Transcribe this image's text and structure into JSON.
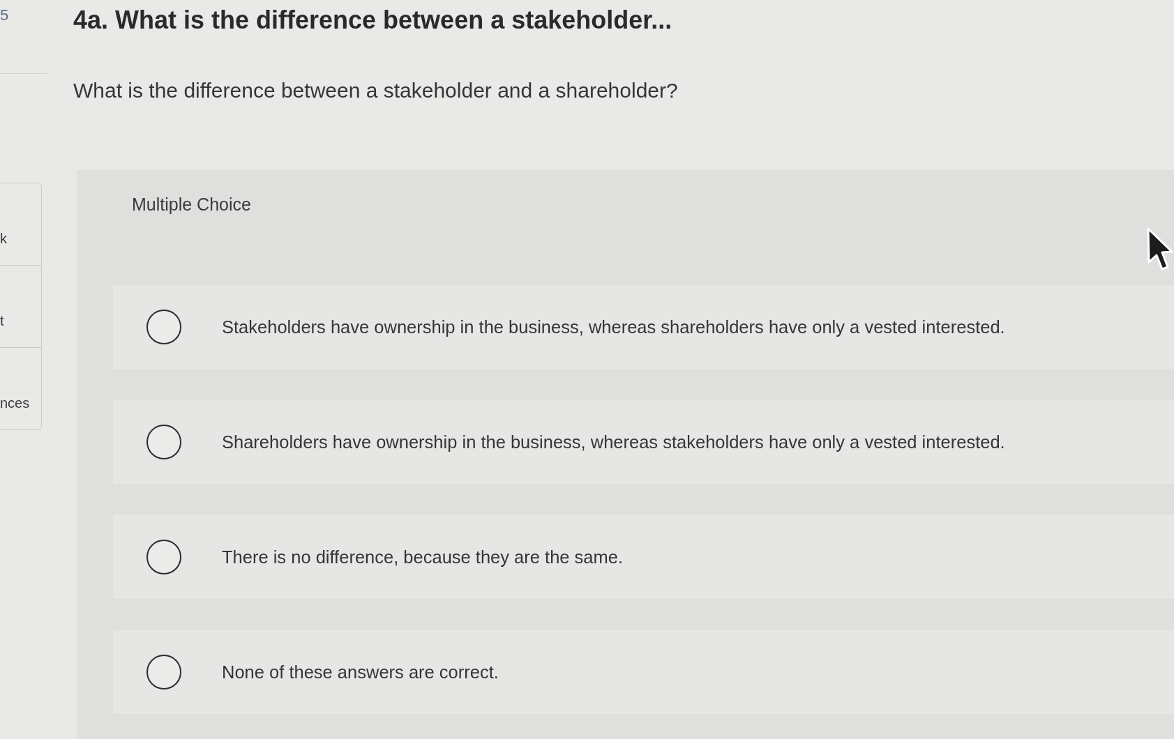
{
  "sidebar": {
    "number": "5",
    "items": [
      {
        "label": "k"
      },
      {
        "label": "t"
      },
      {
        "label": "nces"
      }
    ]
  },
  "question": {
    "title": "4a. What is the difference between a stakeholder...",
    "prompt": "What is the difference between a stakeholder and a shareholder?"
  },
  "answer": {
    "type_label": "Multiple Choice",
    "options": [
      {
        "text": "Stakeholders have ownership in the business, whereas shareholders have only a vested interested.",
        "selected": false
      },
      {
        "text": "Shareholders have ownership in the business, whereas stakeholders have only a vested interested.",
        "selected": false
      },
      {
        "text": "There is no difference, because they are the same.",
        "selected": false
      },
      {
        "text": "None of these answers are correct.",
        "selected": false
      }
    ]
  }
}
